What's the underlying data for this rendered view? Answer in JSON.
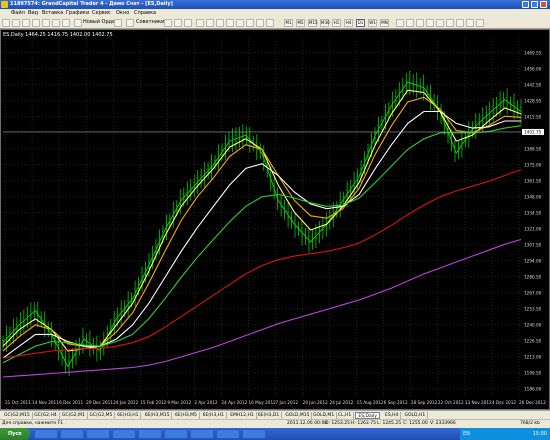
{
  "window": {
    "title": "11897574: GrandCapital Trader 4 - Демо Счет - [ES,Daily]"
  },
  "menu": [
    "Файл",
    "Вид",
    "Вставка",
    "Графики",
    "Сервис",
    "Окно",
    "Справка"
  ],
  "toolbar": {
    "new_order": "Новый Ордер",
    "experts": "Советники",
    "timeframes": [
      "M1",
      "M5",
      "M15",
      "M30",
      "H1",
      "H4",
      "D1",
      "W1",
      "MN"
    ],
    "active_timeframe": "D1"
  },
  "chart": {
    "header": "ES,Daily  1464.25 1416.75 1402.00 1402.75",
    "current_price_label": "1402.75"
  },
  "chart_data": {
    "type": "line",
    "title": "ES,Daily",
    "ylim": [
      1180,
      1482
    ],
    "y_ticks": [
      "1469.55",
      "1456.00",
      "1442.50",
      "1428.95",
      "1415.50",
      "1402.00",
      "1388.50",
      "1375.00",
      "1361.50",
      "1348.00",
      "1334.50",
      "1321.00",
      "1307.50",
      "1294.00",
      "1280.50",
      "1267.00",
      "1253.50",
      "1240.00",
      "1226.50",
      "1213.00",
      "1199.50",
      "1186.00"
    ],
    "x_ticks": [
      "21 Oct 2011",
      "14 Nov 2011",
      "6 Dec 2011",
      "29 Dec 2011",
      "24 Jan 2012",
      "15 Feb 2012",
      "9 Mar 2012",
      "2 Apr 2012",
      "24 Apr 2012",
      "16 May 2012",
      "7 Jun 2012",
      "29 Jun 2012",
      "24 Jul 2012",
      "15 Aug 2012",
      "6 Sep 2012",
      "28 Sep 2012",
      "22 Oct 2012",
      "13 Nov 2012",
      "4 Dec 2012",
      "26 Dec 2012"
    ],
    "series": [
      {
        "color": "#00dd00",
        "values": [
          1225,
          1240,
          1252,
          1232,
          1205,
          1228,
          1218,
          1245,
          1262,
          1290,
          1320,
          1345,
          1360,
          1375,
          1395,
          1400,
          1385,
          1345,
          1325,
          1310,
          1325,
          1345,
          1365,
          1400,
          1425,
          1445,
          1440,
          1420,
          1385,
          1405,
          1418,
          1430,
          1420
        ]
      },
      {
        "color": "#ffff66",
        "values": [
          1222,
          1236,
          1245,
          1236,
          1218,
          1220,
          1222,
          1240,
          1258,
          1285,
          1315,
          1340,
          1357,
          1372,
          1390,
          1397,
          1388,
          1358,
          1335,
          1320,
          1325,
          1340,
          1360,
          1392,
          1418,
          1438,
          1436,
          1420,
          1395,
          1400,
          1412,
          1423,
          1418
        ]
      },
      {
        "color": "#ffaa00",
        "values": [
          1218,
          1230,
          1240,
          1236,
          1224,
          1222,
          1222,
          1234,
          1250,
          1275,
          1302,
          1328,
          1348,
          1364,
          1382,
          1392,
          1388,
          1366,
          1345,
          1332,
          1330,
          1338,
          1355,
          1384,
          1408,
          1428,
          1432,
          1422,
          1404,
          1402,
          1408,
          1416,
          1415
        ]
      },
      {
        "color": "#ffffff",
        "values": [
          1212,
          1222,
          1232,
          1232,
          1226,
          1222,
          1222,
          1228,
          1240,
          1258,
          1280,
          1302,
          1322,
          1340,
          1358,
          1372,
          1376,
          1366,
          1352,
          1342,
          1338,
          1340,
          1350,
          1372,
          1392,
          1410,
          1420,
          1420,
          1410,
          1406,
          1407,
          1412,
          1412
        ]
      },
      {
        "color": "#33cc33",
        "values": [
          1208,
          1215,
          1222,
          1226,
          1225,
          1223,
          1222,
          1226,
          1232,
          1245,
          1262,
          1280,
          1297,
          1312,
          1327,
          1340,
          1348,
          1350,
          1347,
          1343,
          1340,
          1341,
          1347,
          1360,
          1374,
          1388,
          1397,
          1402,
          1402,
          1402,
          1403,
          1406,
          1408
        ]
      },
      {
        "color": "#dd1111",
        "values": [
          1212,
          1214,
          1216,
          1218,
          1219,
          1220,
          1220,
          1222,
          1225,
          1230,
          1238,
          1247,
          1256,
          1265,
          1274,
          1283,
          1290,
          1295,
          1298,
          1300,
          1302,
          1305,
          1309,
          1316,
          1324,
          1333,
          1341,
          1348,
          1353,
          1357,
          1361,
          1366,
          1371
        ]
      },
      {
        "color": "#bb44dd",
        "values": [
          1196,
          1197,
          1198,
          1199,
          1200,
          1201,
          1202,
          1203,
          1204,
          1206,
          1209,
          1213,
          1217,
          1221,
          1226,
          1231,
          1236,
          1241,
          1245,
          1249,
          1253,
          1257,
          1261,
          1266,
          1271,
          1277,
          1283,
          1288,
          1293,
          1298,
          1303,
          1308,
          1312
        ]
      }
    ]
  },
  "sheet_tabs": [
    "GC(G2,M15",
    "GC(G2,H4",
    "GC(G2,M1",
    "GC(G2,M5",
    "6E(H3,H1",
    "6E(H3,M15",
    "6E(H3,M5",
    "6E(H3,H1",
    "EMH12,H1",
    "6E(H3,D1",
    "GOLD,M15",
    "GOLD,M1",
    "CL,H1",
    "ES,Daily",
    "ES,H4",
    "GOLD,H1"
  ],
  "active_sheet": "ES,Daily",
  "status": {
    "help": "Для справки, нажмите F1",
    "datetime": "2011.12.06 00:00",
    "open": "O: 1253.25",
    "high": "H: 1263.75",
    "low": "L: 1245.25",
    "close": "C: 1255.00",
    "volume": "V: 2333966",
    "traffic": "768/2 kb"
  },
  "taskbar": {
    "start_label": "Пуск",
    "tasks": [
      "",
      "",
      "",
      "",
      "",
      "",
      "",
      "",
      ""
    ],
    "lang": "EN",
    "clock": "15:00"
  }
}
